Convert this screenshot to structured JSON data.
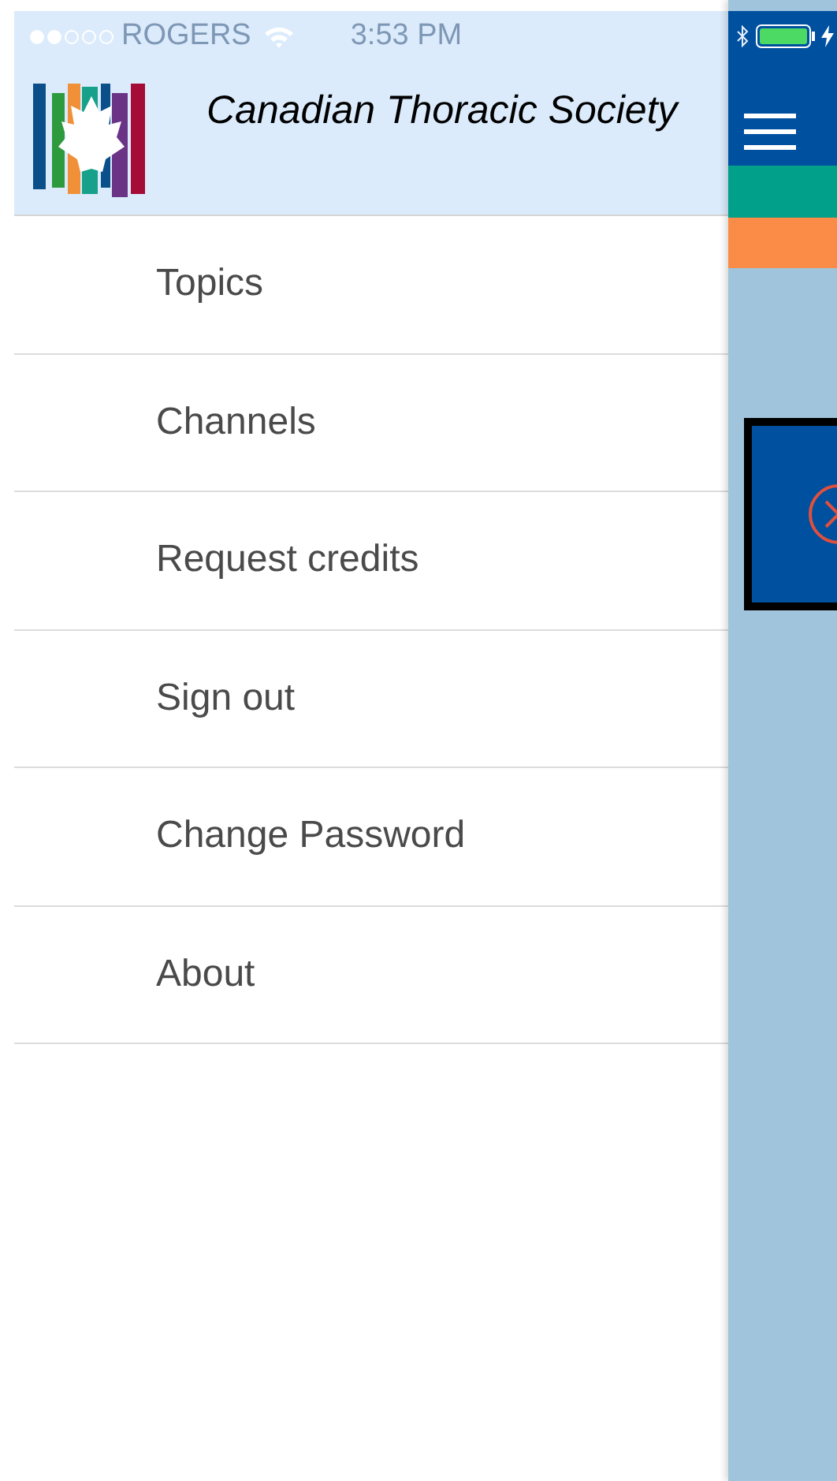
{
  "status_bar": {
    "carrier": "ROGERS",
    "time": "3:53 PM"
  },
  "header": {
    "title": "Canadian Thoracic Society"
  },
  "menu": {
    "items": [
      {
        "label": "Topics"
      },
      {
        "label": "Channels"
      },
      {
        "label": "Request credits"
      },
      {
        "label": "Sign out"
      },
      {
        "label": "Change Password"
      },
      {
        "label": "About"
      }
    ]
  }
}
